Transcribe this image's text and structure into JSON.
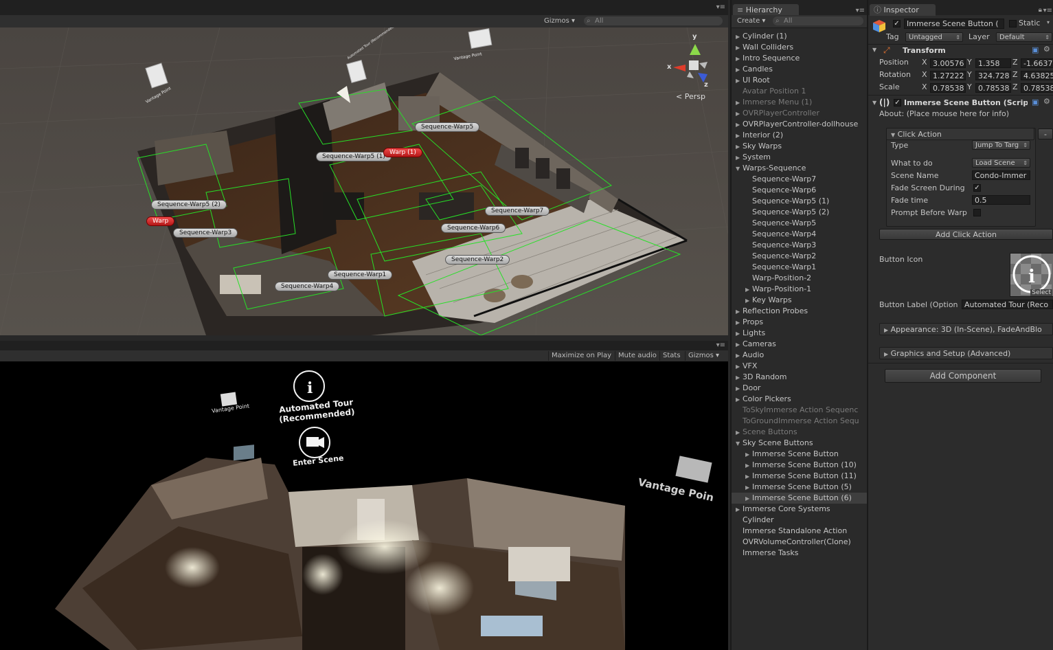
{
  "scene_view": {
    "toolbar": {
      "gizmos": "Gizmos",
      "search_placeholder": "All"
    },
    "gizmo_axes": {
      "x": "x",
      "y": "y",
      "z": "z",
      "persp": "Persp"
    },
    "world_labels": [
      "Vantage Point",
      "Vantage Point",
      "Automated Tour (Recommended)"
    ],
    "warp_labels": [
      {
        "text": "Sequence-Warp5",
        "red": false
      },
      {
        "text": "Sequence-Warp5 (1)",
        "red": false
      },
      {
        "text": "Warp (1)",
        "red": true
      },
      {
        "text": "Sequence-Warp5 (2)",
        "red": false
      },
      {
        "text": "Warp",
        "red": true
      },
      {
        "text": "Sequence-Warp3",
        "red": false
      },
      {
        "text": "Sequence-Warp7",
        "red": false
      },
      {
        "text": "Sequence-Warp6",
        "red": false
      },
      {
        "text": "Sequence-Warp2",
        "red": false
      },
      {
        "text": "Sequence-Warp1",
        "red": false
      },
      {
        "text": "Sequence-Warp4",
        "red": false
      }
    ]
  },
  "game_view": {
    "toolbar": {
      "maximize": "Maximize on Play",
      "mute": "Mute audio",
      "stats": "Stats",
      "gizmos": "Gizmos"
    },
    "overlay": {
      "vantage_small": "Vantage Point",
      "tour_line1": "Automated Tour",
      "tour_line2": "(Recommended)",
      "enter_scene": "Enter Scene",
      "vantage_large": "Vantage Poin"
    }
  },
  "hierarchy": {
    "tab": "Hierarchy",
    "create": "Create",
    "search_placeholder": "All",
    "items": [
      {
        "label": "Cylinder (1)",
        "indent": 0,
        "arrow": "▶",
        "dim": false
      },
      {
        "label": "Wall Colliders",
        "indent": 0,
        "arrow": "▶",
        "dim": false
      },
      {
        "label": "Intro Sequence",
        "indent": 0,
        "arrow": "▶",
        "dim": false
      },
      {
        "label": "Candles",
        "indent": 0,
        "arrow": "▶",
        "dim": false
      },
      {
        "label": "UI Root",
        "indent": 0,
        "arrow": "▶",
        "dim": false
      },
      {
        "label": "Avatar Position 1",
        "indent": 0,
        "arrow": "",
        "dim": true
      },
      {
        "label": "Immerse Menu (1)",
        "indent": 0,
        "arrow": "▶",
        "dim": true
      },
      {
        "label": "OVRPlayerController",
        "indent": 0,
        "arrow": "▶",
        "dim": true
      },
      {
        "label": "OVRPlayerController-dollhouse",
        "indent": 0,
        "arrow": "▶",
        "dim": false
      },
      {
        "label": "Interior (2)",
        "indent": 0,
        "arrow": "▶",
        "dim": false
      },
      {
        "label": "Sky Warps",
        "indent": 0,
        "arrow": "▶",
        "dim": false
      },
      {
        "label": "System",
        "indent": 0,
        "arrow": "▶",
        "dim": false
      },
      {
        "label": "Warps-Sequence",
        "indent": 0,
        "arrow": "▼",
        "dim": false
      },
      {
        "label": "Sequence-Warp7",
        "indent": 1,
        "arrow": "",
        "dim": false
      },
      {
        "label": "Sequence-Warp6",
        "indent": 1,
        "arrow": "",
        "dim": false
      },
      {
        "label": "Sequence-Warp5 (1)",
        "indent": 1,
        "arrow": "",
        "dim": false
      },
      {
        "label": "Sequence-Warp5 (2)",
        "indent": 1,
        "arrow": "",
        "dim": false
      },
      {
        "label": "Sequence-Warp5",
        "indent": 1,
        "arrow": "",
        "dim": false
      },
      {
        "label": "Sequence-Warp4",
        "indent": 1,
        "arrow": "",
        "dim": false
      },
      {
        "label": "Sequence-Warp3",
        "indent": 1,
        "arrow": "",
        "dim": false
      },
      {
        "label": "Sequence-Warp2",
        "indent": 1,
        "arrow": "",
        "dim": false
      },
      {
        "label": "Sequence-Warp1",
        "indent": 1,
        "arrow": "",
        "dim": false
      },
      {
        "label": "Warp-Position-2",
        "indent": 1,
        "arrow": "",
        "dim": false
      },
      {
        "label": "Warp-Position-1",
        "indent": 1,
        "arrow": "▶",
        "dim": false
      },
      {
        "label": "Key Warps",
        "indent": 1,
        "arrow": "▶",
        "dim": false
      },
      {
        "label": "Reflection Probes",
        "indent": 0,
        "arrow": "▶",
        "dim": false
      },
      {
        "label": "Props",
        "indent": 0,
        "arrow": "▶",
        "dim": false
      },
      {
        "label": "Lights",
        "indent": 0,
        "arrow": "▶",
        "dim": false
      },
      {
        "label": "Cameras",
        "indent": 0,
        "arrow": "▶",
        "dim": false
      },
      {
        "label": "Audio",
        "indent": 0,
        "arrow": "▶",
        "dim": false
      },
      {
        "label": "VFX",
        "indent": 0,
        "arrow": "▶",
        "dim": false
      },
      {
        "label": "3D Random",
        "indent": 0,
        "arrow": "▶",
        "dim": false
      },
      {
        "label": "Door",
        "indent": 0,
        "arrow": "▶",
        "dim": false
      },
      {
        "label": "Color Pickers",
        "indent": 0,
        "arrow": "▶",
        "dim": false
      },
      {
        "label": "ToSkyImmerse Action Sequenc",
        "indent": 0,
        "arrow": "",
        "dim": true
      },
      {
        "label": "ToGroundImmerse Action Sequ",
        "indent": 0,
        "arrow": "",
        "dim": true
      },
      {
        "label": "Scene Buttons",
        "indent": 0,
        "arrow": "▶",
        "dim": true
      },
      {
        "label": "Sky Scene Buttons",
        "indent": 0,
        "arrow": "▼",
        "dim": false
      },
      {
        "label": "Immerse Scene Button",
        "indent": 1,
        "arrow": "▶",
        "dim": false
      },
      {
        "label": "Immerse Scene Button (10)",
        "indent": 1,
        "arrow": "▶",
        "dim": false
      },
      {
        "label": "Immerse Scene Button (11)",
        "indent": 1,
        "arrow": "▶",
        "dim": false
      },
      {
        "label": "Immerse Scene Button (5)",
        "indent": 1,
        "arrow": "▶",
        "dim": false
      },
      {
        "label": "Immerse Scene Button (6)",
        "indent": 1,
        "arrow": "▶",
        "dim": false,
        "selected": true
      },
      {
        "label": "Immerse Core Systems",
        "indent": 0,
        "arrow": "▶",
        "dim": false
      },
      {
        "label": "Cylinder",
        "indent": 0,
        "arrow": "",
        "dim": false
      },
      {
        "label": "Immerse Standalone Action",
        "indent": 0,
        "arrow": "",
        "dim": false
      },
      {
        "label": "OVRVolumeController(Clone)",
        "indent": 0,
        "arrow": "",
        "dim": false
      },
      {
        "label": "Immerse Tasks",
        "indent": 0,
        "arrow": "",
        "dim": false
      }
    ]
  },
  "inspector": {
    "tab": "Inspector",
    "object_name": "Immerse Scene Button (",
    "static_label": "Static",
    "tag_label": "Tag",
    "tag_value": "Untagged",
    "layer_label": "Layer",
    "layer_value": "Default",
    "transform": {
      "title": "Transform",
      "position_label": "Position",
      "rotation_label": "Rotation",
      "scale_label": "Scale",
      "position": {
        "x": "3.00576",
        "y": "1.358",
        "z": "-1.6637"
      },
      "rotation": {
        "x": "1.27222",
        "y": "324.728",
        "z": "4.63825"
      },
      "scale": {
        "x": "0.78538",
        "y": "0.78538",
        "z": "0.78538"
      },
      "axis_x": "X",
      "axis_y": "Y",
      "axis_z": "Z"
    },
    "script": {
      "title": "Immerse Scene Button (Scrip",
      "about": "About: (Place mouse here for info)",
      "click_action_title": "Click Action",
      "type_label": "Type",
      "type_value": "Jump To Targ",
      "what_label": "What to do",
      "what_value": "Load Scene",
      "scene_name_label": "Scene Name",
      "scene_name_value": "Condo-Immer",
      "fade_during_label": "Fade Screen During",
      "fade_time_label": "Fade time",
      "fade_time_value": "0.5",
      "prompt_label": "Prompt Before Warp",
      "minus": "-",
      "add_click_action": "Add Click Action",
      "button_icon_label": "Button Icon",
      "select": "Select",
      "button_label_label": "Button Label (Option",
      "button_label_value": "Automated Tour (Reco",
      "appearance": "Appearance: 3D (In-Scene), FadeAndBlo",
      "graphics": "Graphics and Setup (Advanced)"
    },
    "add_component": "Add Component"
  }
}
